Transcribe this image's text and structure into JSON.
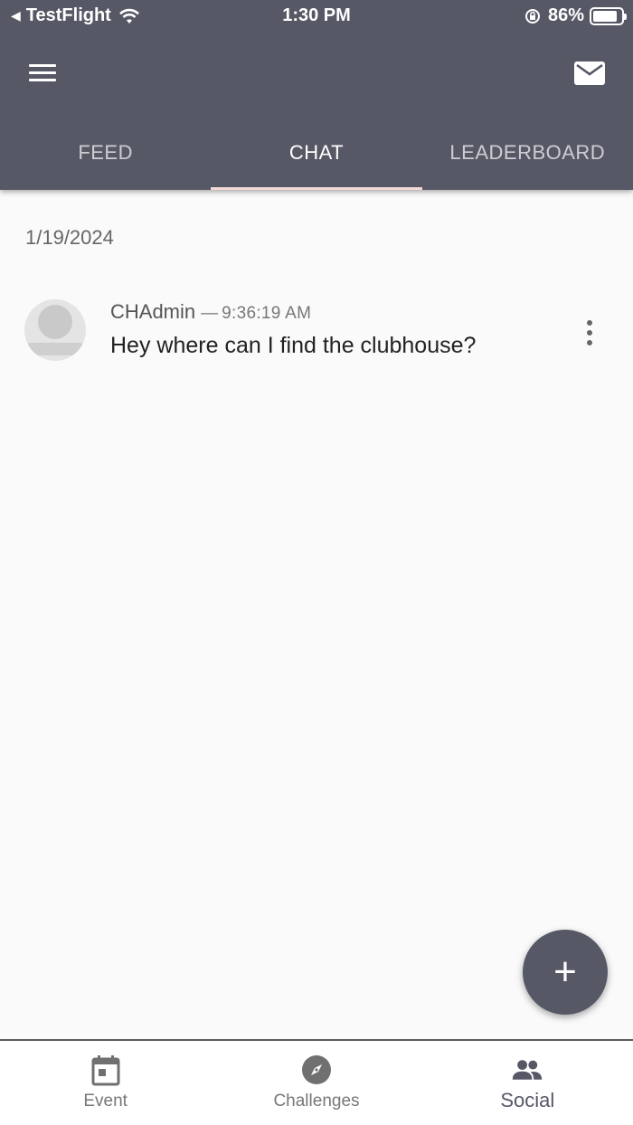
{
  "status_bar": {
    "back_app": "TestFlight",
    "time": "1:30 PM",
    "battery": "86%",
    "battery_level": 0.86,
    "icons": [
      "back-arrow-icon",
      "wifi-icon",
      "orientation-lock-icon",
      "battery-icon"
    ]
  },
  "header": {
    "menu_icon": "hamburger-menu-icon",
    "mail_icon": "mail-icon"
  },
  "tabs": [
    {
      "label": "FEED",
      "active": false
    },
    {
      "label": "CHAT",
      "active": true
    },
    {
      "label": "LEADERBOARD",
      "active": false
    }
  ],
  "chat": {
    "date": "1/19/2024",
    "messages": [
      {
        "author": "CHAdmin",
        "separator": "—",
        "time": "9:36:19 AM",
        "text": "Hey where can I find the clubhouse?",
        "avatar_icon": "user-avatar-icon",
        "menu_icon": "more-vert-icon"
      }
    ]
  },
  "fab": {
    "icon": "plus-icon",
    "symbol": "+"
  },
  "bottom_nav": [
    {
      "label": "Event",
      "icon": "calendar-icon",
      "active": false
    },
    {
      "label": "Challenges",
      "icon": "compass-icon",
      "active": false
    },
    {
      "label": "Social",
      "icon": "people-icon",
      "active": true
    }
  ],
  "colors": {
    "app_bar": "#565866",
    "tab_indicator": "#f4d9d6",
    "background": "#fafafa",
    "fab": "#565866"
  }
}
